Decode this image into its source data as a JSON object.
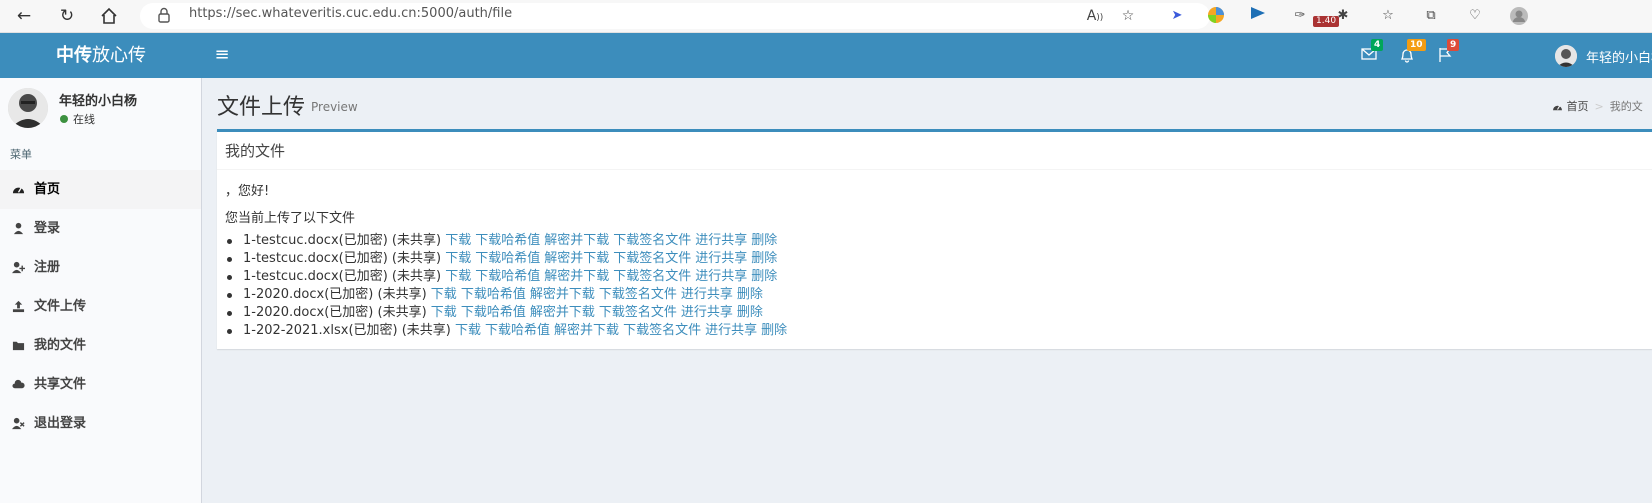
{
  "browser": {
    "url": "https://sec.whateveritis.cuc.edu.cn:5000/auth/file",
    "extension_badge": "1.40"
  },
  "header": {
    "logo_bold": "中传",
    "logo_rest": "放心传",
    "messages_count": "4",
    "notifications_count": "10",
    "tasks_count": "9",
    "user_name": "年轻的小白杨",
    "colors": {
      "primary": "#3c8dbc",
      "green": "#00a65a",
      "orange": "#f39c12",
      "red": "#dd4b39"
    }
  },
  "sidebar": {
    "user_name": "年轻的小白杨",
    "status": "在线",
    "menu_header": "菜单",
    "items": [
      {
        "label": "首页",
        "icon": "dashboard-icon"
      },
      {
        "label": "登录",
        "icon": "user-icon"
      },
      {
        "label": "注册",
        "icon": "user-plus-icon"
      },
      {
        "label": "文件上传",
        "icon": "upload-icon"
      },
      {
        "label": "我的文件",
        "icon": "folder-icon"
      },
      {
        "label": "共享文件",
        "icon": "cloud-icon"
      },
      {
        "label": "退出登录",
        "icon": "user-times-icon"
      }
    ]
  },
  "content": {
    "title": "文件上传",
    "subtitle": "Preview",
    "breadcrumb": {
      "home": "首页",
      "current": "我的文"
    },
    "box_title": "我的文件",
    "greeting": "，您好!",
    "intro": "您当前上传了以下文件",
    "actions": {
      "download": "下载",
      "download_hash": "下载哈希值",
      "decrypt_download": "解密并下载",
      "download_sig": "下载签名文件",
      "share": "进行共享",
      "delete": "删除"
    },
    "files": [
      {
        "name": "1-testcuc.docx(已加密) (未共享)"
      },
      {
        "name": "1-testcuc.docx(已加密) (未共享)"
      },
      {
        "name": "1-testcuc.docx(已加密) (未共享)"
      },
      {
        "name": "1-2020.docx(已加密) (未共享)"
      },
      {
        "name": "1-2020.docx(已加密) (未共享)"
      },
      {
        "name": "1-202-2021.xlsx(已加密) (未共享)"
      }
    ]
  }
}
